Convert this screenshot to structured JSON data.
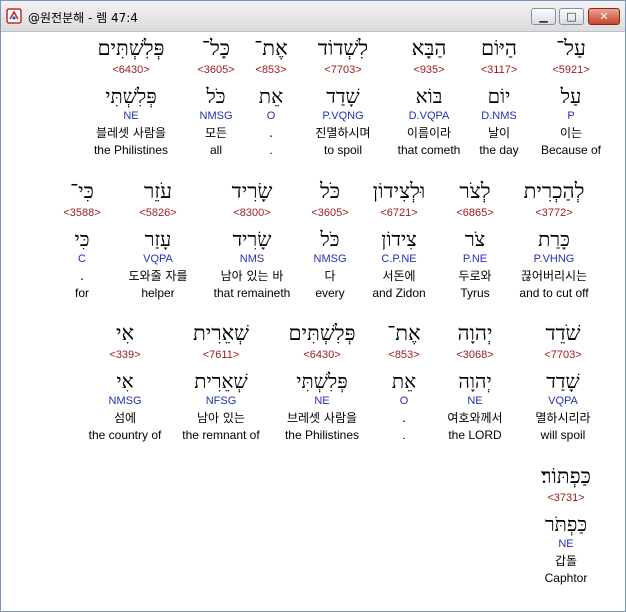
{
  "window": {
    "title": "@원전분해 - 렘 47:4",
    "min_glyph": "▁",
    "max_glyph": "□",
    "close_glyph": "✕"
  },
  "verse": {
    "rows": [
      {
        "words": [
          {
            "hebrew": "עַל־",
            "strong": "<5921>",
            "lemma": "עַל",
            "parse": "P",
            "korean": "이는",
            "english": "Because of"
          },
          {
            "hebrew": "הַיּוֹם",
            "strong": "<3117>",
            "lemma": "יוֹם",
            "parse": "D.NMS",
            "korean": "날이",
            "english": "the day"
          },
          {
            "hebrew": "הַבָּא",
            "strong": "<935>",
            "lemma": "בּוֹא",
            "parse": "D.VQPA",
            "korean": "이름이라",
            "english": "that cometh"
          },
          {
            "hebrew": "לִשְׁדוֹד",
            "strong": "<7703>",
            "lemma": "שָׁדַד",
            "parse": "P.VQNG",
            "korean": "진멸하시며",
            "english": "to spoil"
          },
          {
            "hebrew": "אֶת־",
            "strong": "<853>",
            "lemma": "אֵת",
            "parse": "O",
            "korean": ".",
            "english": "."
          },
          {
            "hebrew": "כָּל־",
            "strong": "<3605>",
            "lemma": "כֹּל",
            "parse": "NMSG",
            "korean": "모든",
            "english": "all"
          },
          {
            "hebrew": "פְּלִשְׁתִּים",
            "strong": "<6430>",
            "lemma": "פְּלִשְׁתִּי",
            "parse": "NE",
            "korean": "블레셋 사람을",
            "english": "the Philistines"
          }
        ]
      },
      {
        "words": [
          {
            "hebrew": "לְהַכְרִית",
            "strong": "<3772>",
            "lemma": "כָּרַת",
            "parse": "P.VHNG",
            "korean": "끊어버리시는",
            "english": "and to cut off"
          },
          {
            "hebrew": "לְצֹר",
            "strong": "<6865>",
            "lemma": "צֹר",
            "parse": "P.NE",
            "korean": "두로와",
            "english": "Tyrus"
          },
          {
            "hebrew": "וּלְצִידוֹן",
            "strong": "<6721>",
            "lemma": "צִידוֹן",
            "parse": "C.P.NE",
            "korean": "서돈에",
            "english": "and Zidon"
          },
          {
            "hebrew": "כֹּל",
            "strong": "<3605>",
            "lemma": "כֹּל",
            "parse": "NMSG",
            "korean": "다",
            "english": "every"
          },
          {
            "hebrew": "שָׂרִיד",
            "strong": "<8300>",
            "lemma": "שָׂרִיד",
            "parse": "NMS",
            "korean": "남아 있는 바",
            "english": "that remaineth"
          },
          {
            "hebrew": "עֹזֵר",
            "strong": "<5826>",
            "lemma": "עָזַר",
            "parse": "VQPA",
            "korean": "도와줄 자를",
            "english": "helper"
          },
          {
            "hebrew": "כִּי־",
            "strong": "<3588>",
            "lemma": "כִּי",
            "parse": "C",
            "korean": ".",
            "english": "for"
          }
        ]
      },
      {
        "words": [
          {
            "hebrew": "שֹׁדֵד",
            "strong": "<7703>",
            "lemma": "שָׁדַד",
            "parse": "VQPA",
            "korean": "멸하시리라",
            "english": "will spoil"
          },
          {
            "hebrew": "יְהוָה",
            "strong": "<3068>",
            "lemma": "יְהוָה",
            "parse": "NE",
            "korean": "여호와께서",
            "english": "the LORD"
          },
          {
            "hebrew": "אֶת־",
            "strong": "<853>",
            "lemma": "אֵת",
            "parse": "O",
            "korean": ".",
            "english": "."
          },
          {
            "hebrew": "פְּלִשְׁתִּים",
            "strong": "<6430>",
            "lemma": "פְּלִשְׁתִּי",
            "parse": "NE",
            "korean": "브레셋 사람을",
            "english": "the Philistines"
          },
          {
            "hebrew": "שְׁאֵרִית",
            "strong": "<7611>",
            "lemma": "שְׁאֵרִית",
            "parse": "NFSG",
            "korean": "남아 있는",
            "english": "the remnant of"
          },
          {
            "hebrew": "אִי",
            "strong": "<339>",
            "lemma": "אִי",
            "parse": "NMSG",
            "korean": "섬에",
            "english": "the country of"
          }
        ]
      },
      {
        "words": [
          {
            "hebrew": "כַּפְתּוֹר׃",
            "strong": "<3731>",
            "lemma": "כַּפְתֹּר",
            "parse": "NE",
            "korean": "갑돌",
            "english": "Caphtor"
          }
        ]
      }
    ]
  }
}
